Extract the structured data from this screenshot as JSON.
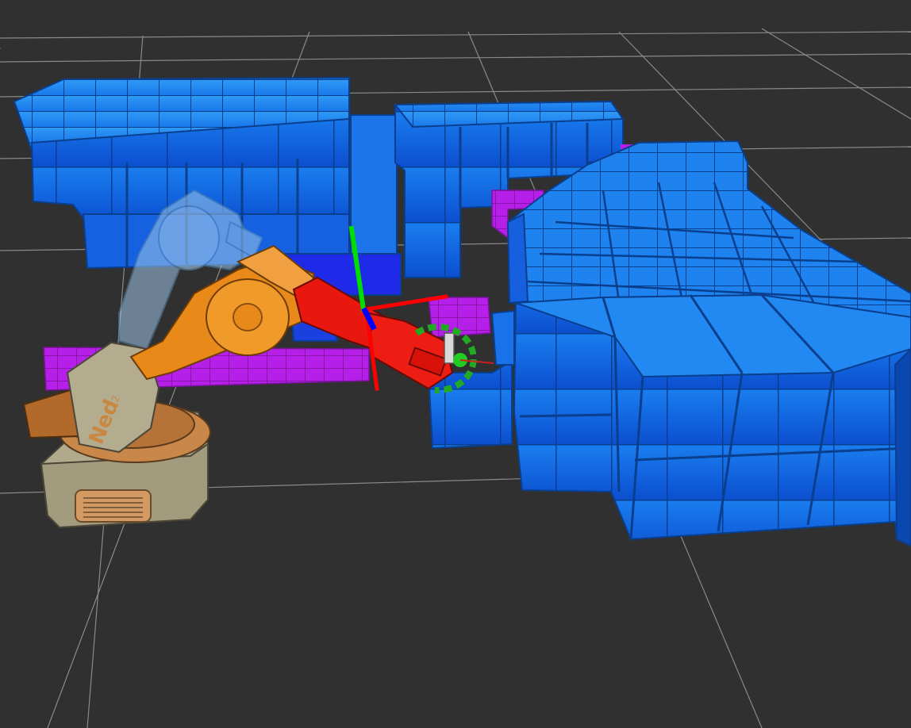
{
  "scene": {
    "background": "#303030",
    "grid_color": "#9a9a9a",
    "robot_label": "Ned",
    "robot_label_superscript": "2"
  },
  "colors": {
    "voxel_blue": "#1a6fe6",
    "voxel_blue_light": "#2f93f5",
    "voxel_blue_dark": "#0d49b4",
    "voxel_magenta": "#b421e6",
    "robot_orange": "#e88a17",
    "robot_beige": "#b6af91",
    "robot_collision_red": "#e81a12",
    "robot_ghost": "#8fb6d6",
    "axis_x": "#ff0000",
    "axis_y": "#00dd00",
    "axis_z": "#0000ff"
  },
  "icons": [
    "interactive-marker-axis-icon",
    "rotation-ring-icon"
  ]
}
